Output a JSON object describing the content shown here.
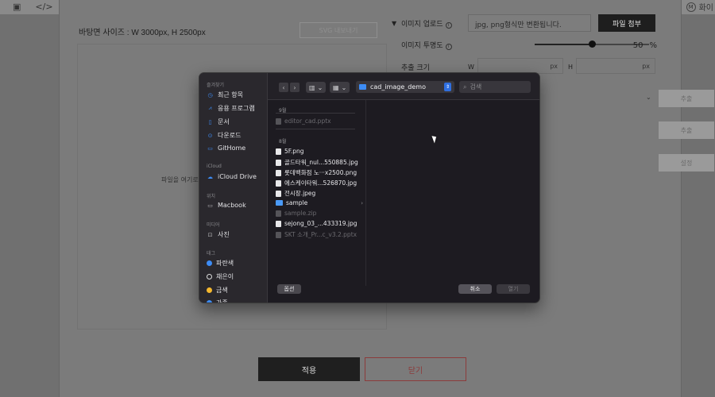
{
  "host": {
    "right_chip": "화이"
  },
  "editor": {
    "bg_size": "바탕면 사이즈 : W 3000px, H 2500px",
    "ghost_button": "SVG 내보내기",
    "drop_hint": "파일을 여기로",
    "upload_label": "이미지 업로드",
    "upload_placeholder": "jpg, png형식만 변환됩니다.",
    "attach_button": "파일 첨부",
    "opacity_label": "이미지 투명도",
    "opacity_value": 50,
    "opacity_unit": "%",
    "size_label": "추출 크기",
    "w_label": "W",
    "h_label": "H",
    "px_unit": "px",
    "extract_button_1": "추출",
    "extract_button_2": "추출",
    "settings_button": "설정",
    "apply_button": "적용",
    "close_button": "닫기"
  },
  "dialog": {
    "sidebar": {
      "favorites_title": "즐겨찾기",
      "favorites": [
        {
          "label": "최근 항목",
          "icon": "clock-icon"
        },
        {
          "label": "응용 프로그램",
          "icon": "apps-icon"
        },
        {
          "label": "문서",
          "icon": "document-icon"
        },
        {
          "label": "다운로드",
          "icon": "download-icon"
        },
        {
          "label": "GitHome",
          "icon": "folder-icon"
        }
      ],
      "icloud_title": "iCloud",
      "icloud": [
        {
          "label": "iCloud Drive",
          "icon": "cloud-icon"
        }
      ],
      "location_title": "위치",
      "locations": [
        {
          "label": "Macbook",
          "icon": "laptop-icon"
        }
      ],
      "media_title": "미디어",
      "media": [
        {
          "label": "사진",
          "icon": "photo-icon"
        }
      ],
      "tags_title": "태그",
      "tags": [
        {
          "label": "파란색",
          "color": "#3d8cf5"
        },
        {
          "label": "채은이",
          "color": "#ffffff"
        },
        {
          "label": "금색",
          "color": "#f5b82e"
        },
        {
          "label": "가족",
          "color": "#3d8cf5"
        }
      ]
    },
    "path": "cad_image_demo",
    "search_placeholder": "검색",
    "groups": [
      {
        "title": "9월",
        "files": [
          {
            "name": "editor_cad.pptx",
            "dim": true,
            "type": "file"
          }
        ]
      },
      {
        "title": "8월",
        "files": [
          {
            "name": "5F.png",
            "dim": false,
            "type": "file"
          },
          {
            "name": "골드타워_nul...550885.jpg",
            "dim": false,
            "type": "file"
          },
          {
            "name": "롯데백화점 노···x2500.png",
            "dim": false,
            "type": "file"
          },
          {
            "name": "에스케이타워...526870.jpg",
            "dim": false,
            "type": "file"
          },
          {
            "name": "전시장.jpeg",
            "dim": false,
            "type": "file"
          },
          {
            "name": "sample",
            "dim": false,
            "type": "folder"
          },
          {
            "name": "sample.zip",
            "dim": true,
            "type": "file"
          },
          {
            "name": "sejong_03_...433319.jpg",
            "dim": false,
            "type": "file"
          },
          {
            "name": "SKT 소개_Pr...c_v3.2.pptx",
            "dim": true,
            "type": "file"
          }
        ]
      }
    ],
    "options_button": "옵션",
    "cancel_button": "취소",
    "open_button": "열기"
  }
}
